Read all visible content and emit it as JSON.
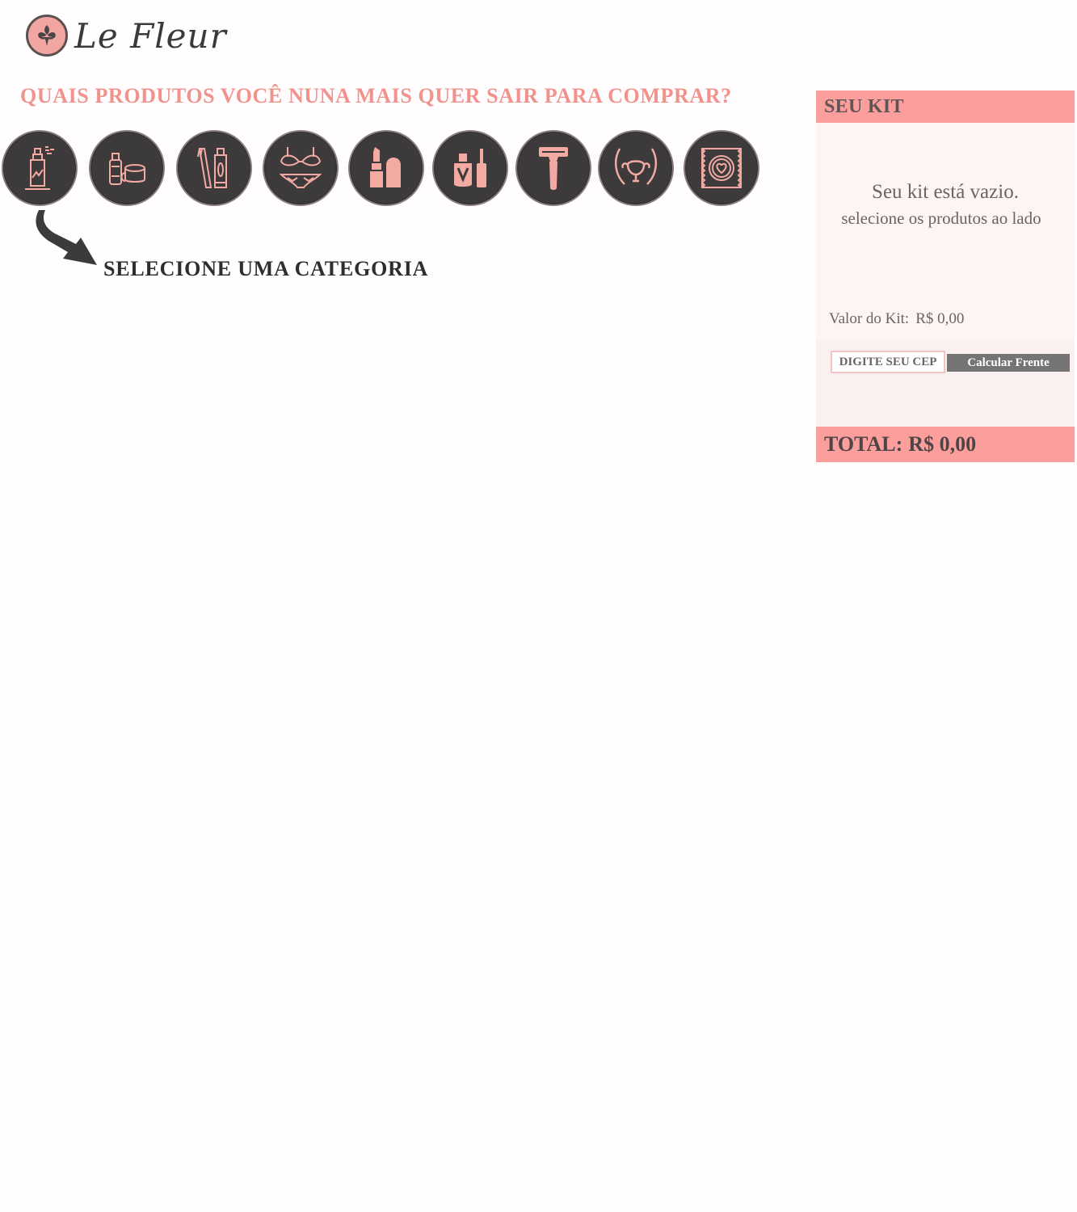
{
  "brand": {
    "name": "Le Fleur"
  },
  "main": {
    "question": "QUAIS PRODUTOS VOCÊ NUNA MAIS QUER SAIR PARA COMPRAR?",
    "hint": "SELECIONE UMA CATEGORIA",
    "categories": [
      {
        "icon": "perfume-spray-icon"
      },
      {
        "icon": "lotion-cream-icon"
      },
      {
        "icon": "toothbrush-toothpaste-icon"
      },
      {
        "icon": "lingerie-icon"
      },
      {
        "icon": "lipstick-icon"
      },
      {
        "icon": "nail-polish-icon"
      },
      {
        "icon": "razor-icon"
      },
      {
        "icon": "uterus-icon"
      },
      {
        "icon": "condom-icon"
      }
    ]
  },
  "kit": {
    "title": "SEU KIT",
    "empty_line1": "Seu kit está vazio.",
    "empty_line2": "selecione os produtos ao lado",
    "value_label": "Valor do Kit:",
    "value": "R$ 0,00",
    "cep_placeholder": "DIGITE SEU CEP",
    "calc_button": "Calcular Frente",
    "total_label": "TOTAL:",
    "total_value": "R$ 0,00"
  },
  "colors": {
    "accent": "#f1928c",
    "header_pink": "#fc9f9c",
    "icon_dark": "#3c3a3b",
    "icon_pink": "#f2aaa3",
    "panel_bg": "#fdf4f4"
  }
}
